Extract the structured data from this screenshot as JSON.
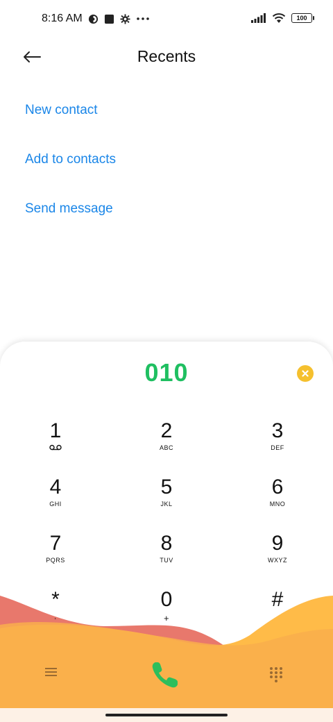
{
  "status_bar": {
    "time": "8:16 AM",
    "icons_left": [
      "vpn-icon",
      "square-notification-icon",
      "settings-icon",
      "more-dots-icon"
    ],
    "icons_right": [
      "signal-icon",
      "wifi-icon",
      "battery-icon"
    ],
    "battery_level": "100"
  },
  "header": {
    "title": "Recents",
    "back_icon": "arrow-left-icon"
  },
  "actions": {
    "new_contact": "New contact",
    "add_to_contacts": "Add to contacts",
    "send_message": "Send message"
  },
  "dialer": {
    "number": "010",
    "keys": [
      {
        "digit": "1",
        "letters": ""
      },
      {
        "digit": "2",
        "letters": "ABC"
      },
      {
        "digit": "3",
        "letters": "DEF"
      },
      {
        "digit": "4",
        "letters": "GHI"
      },
      {
        "digit": "5",
        "letters": "JKL"
      },
      {
        "digit": "6",
        "letters": "MNO"
      },
      {
        "digit": "7",
        "letters": "PQRS"
      },
      {
        "digit": "8",
        "letters": "TUV"
      },
      {
        "digit": "9",
        "letters": "WXYZ"
      },
      {
        "digit": "*",
        "letters": ","
      },
      {
        "digit": "0",
        "letters": "+"
      },
      {
        "digit": "#",
        "letters": ""
      }
    ]
  },
  "colors": {
    "accent_blue": "#1a86e8",
    "number_green": "#1fbf61",
    "clear_yellow": "#f5c02e",
    "wave_red": "#e8786c",
    "wave_orange": "#f9ae4c",
    "wave_yellow": "#ffbb48",
    "call_green": "#2dbe5c"
  }
}
